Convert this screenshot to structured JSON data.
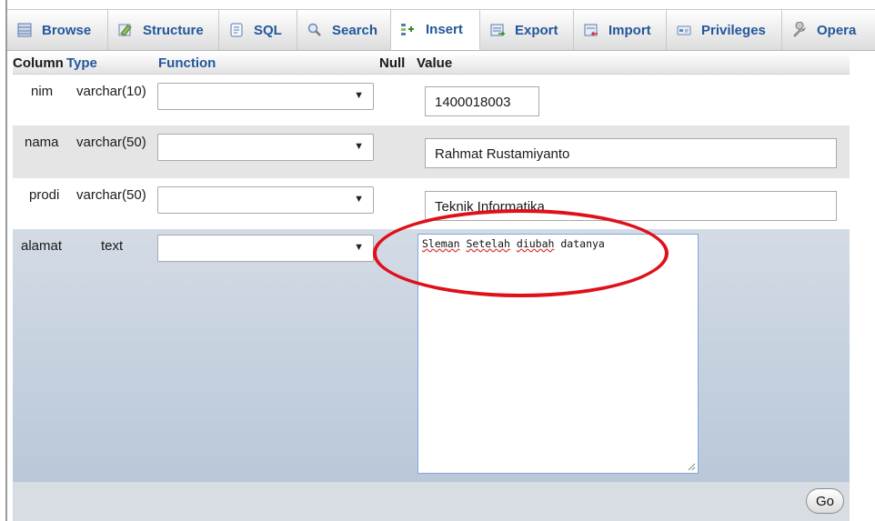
{
  "tabs": [
    {
      "label": "Browse",
      "icon": "browse-icon"
    },
    {
      "label": "Structure",
      "icon": "structure-icon"
    },
    {
      "label": "SQL",
      "icon": "sql-icon"
    },
    {
      "label": "Search",
      "icon": "search-icon"
    },
    {
      "label": "Insert",
      "icon": "insert-icon",
      "active": true
    },
    {
      "label": "Export",
      "icon": "export-icon"
    },
    {
      "label": "Import",
      "icon": "import-icon"
    },
    {
      "label": "Privileges",
      "icon": "privileges-icon"
    },
    {
      "label": "Opera",
      "icon": "operations-icon"
    }
  ],
  "table": {
    "headers": {
      "column": "Column",
      "type": "Type",
      "function": "Function",
      "null": "Null",
      "value": "Value"
    },
    "rows": [
      {
        "column": "nim",
        "type": "varchar(10)",
        "value": "1400018003"
      },
      {
        "column": "nama",
        "type": "varchar(50)",
        "value": "Rahmat Rustamiyanto"
      },
      {
        "column": "prodi",
        "type": "varchar(50)",
        "value": "Teknik Informatika"
      },
      {
        "column": "alamat",
        "type": "text",
        "value_words": [
          "Sleman",
          "Setelah",
          "diubah",
          "datanya"
        ]
      }
    ]
  },
  "go_label": "Go",
  "colors": {
    "link": "#23579b",
    "highlight_circle": "#e0101a",
    "textarea_border": "#7fa8e0"
  }
}
